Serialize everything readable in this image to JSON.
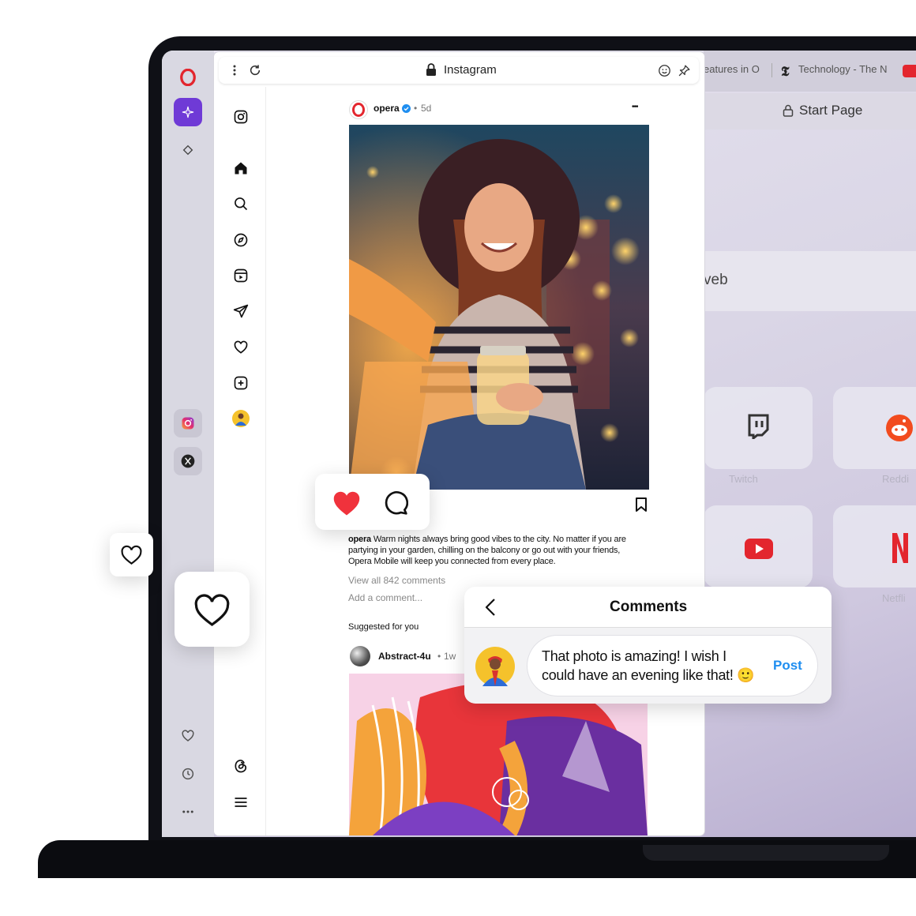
{
  "ig_window": {
    "title": "Instagram"
  },
  "post": {
    "username": "opera",
    "age": "5d",
    "more": "•••",
    "caption_user": "opera",
    "caption_text": "Warm nights always bring good vibes to the city. No matter if you are partying in your garden, chilling on the balcony or go out with your friends, Opera Mobile will keep you connected from every place.",
    "view_comments": "View all 842 comments",
    "add_comment_placeholder": "Add a comment..."
  },
  "suggested": {
    "heading": "Suggested for you",
    "username": "Abstract-4u",
    "age": "1w"
  },
  "comments_card": {
    "title": "Comments",
    "text": "That photo is amazing! I wish I could have an evening like that! 🙂",
    "post_label": "Post"
  },
  "background_browser": {
    "tab1": "eatures in O",
    "tab2": "Technology - The N",
    "start_page": "Start Page",
    "search_fragment": "veb",
    "speed_dials": [
      "Twitch",
      "Reddit",
      "YouTube",
      "Netflix"
    ],
    "speed_dial_labels": [
      "Twitch",
      "Reddi",
      "",
      "Netfli"
    ]
  },
  "colors": {
    "opera_red": "#e3262e",
    "accent_purple": "#6f3ad6",
    "like_red": "#f0323c",
    "link_blue": "#1f8ef0"
  },
  "icons": {
    "sidebar": [
      "opera-logo-icon",
      "aria-sparkle-icon",
      "diamond-icon",
      "instagram-icon",
      "x-twitter-icon",
      "heart-icon",
      "clock-icon",
      "more-icon"
    ],
    "ig_nav": [
      "instagram-icon",
      "home-icon",
      "search-icon",
      "explore-icon",
      "reels-icon",
      "send-icon",
      "heart-icon",
      "create-icon",
      "profile-avatar",
      "threads-icon",
      "menu-icon"
    ]
  }
}
